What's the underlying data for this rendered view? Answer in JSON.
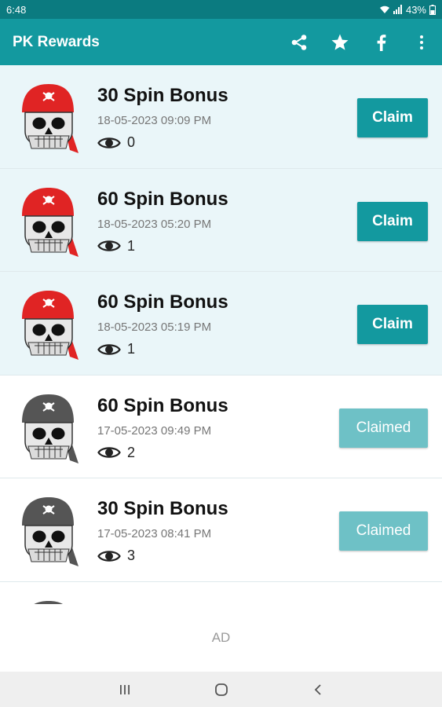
{
  "status_bar": {
    "time": "6:48",
    "battery": "43%",
    "icons": [
      "wifi-icon",
      "signal-icon",
      "battery-icon"
    ]
  },
  "app_bar": {
    "title": "PK Rewards",
    "actions": [
      "share-icon",
      "star-icon",
      "facebook-icon",
      "more-vert-icon"
    ]
  },
  "rewards": [
    {
      "title": "30 Spin Bonus",
      "date": "18-05-2023 09:09 PM",
      "views": "0",
      "button": "Claim",
      "status": "unclaimed"
    },
    {
      "title": "60 Spin Bonus",
      "date": "18-05-2023 05:20 PM",
      "views": "1",
      "button": "Claim",
      "status": "unclaimed"
    },
    {
      "title": "60 Spin Bonus",
      "date": "18-05-2023 05:19 PM",
      "views": "1",
      "button": "Claim",
      "status": "unclaimed"
    },
    {
      "title": "60 Spin Bonus",
      "date": "17-05-2023 09:49 PM",
      "views": "2",
      "button": "Claimed",
      "status": "claimed"
    },
    {
      "title": "30 Spin Bonus",
      "date": "17-05-2023 08:41 PM",
      "views": "3",
      "button": "Claimed",
      "status": "claimed"
    }
  ],
  "ad": {
    "label": "AD"
  },
  "colors": {
    "status_bar": "#0b7b80",
    "app_bar": "#13999f",
    "claim_button": "#13999f",
    "claimed_button": "#6ec1c6",
    "unclaimed_row": "#eaf6f9",
    "bandana_active": "#e02424",
    "bandana_claimed": "#555555"
  },
  "nav_bar": {
    "buttons": [
      "recent-apps-icon",
      "home-icon",
      "back-icon"
    ]
  }
}
